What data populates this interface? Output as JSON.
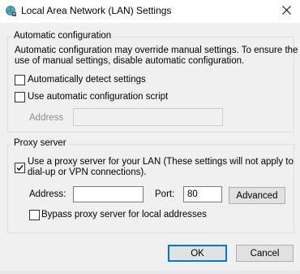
{
  "window": {
    "title": "Local Area Network (LAN) Settings",
    "icon": "network-globe-icon"
  },
  "auto_config": {
    "group_label": "Automatic configuration",
    "description_line1": "Automatic configuration may override manual settings.  To ensure the",
    "description_line2": "use of manual settings, disable automatic configuration.",
    "detect_label": "Automatically detect settings",
    "detect_checked": false,
    "script_label": "Use automatic configuration script",
    "script_checked": false,
    "address_label": "Address",
    "address_value": ""
  },
  "proxy": {
    "group_label": "Proxy server",
    "use_proxy_line1": "Use a proxy server for your LAN (These settings will not apply to",
    "use_proxy_line2": "dial-up or VPN connections).",
    "use_proxy_checked": true,
    "address_label": "Address:",
    "address_value": "",
    "port_label": "Port:",
    "port_value": "80",
    "advanced_label": "Advanced",
    "bypass_label": "Bypass proxy server for local addresses",
    "bypass_checked": false
  },
  "buttons": {
    "ok": "OK",
    "cancel": "Cancel"
  },
  "colors": {
    "accent": "#0078d7"
  }
}
